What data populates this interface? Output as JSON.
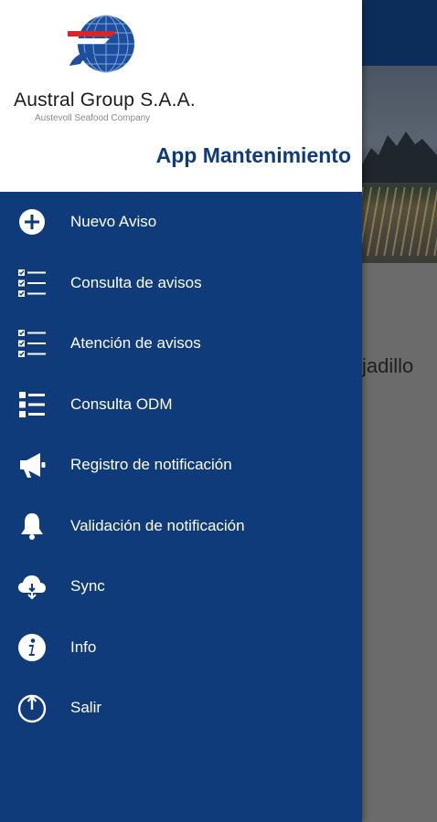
{
  "background": {
    "partial_text": "jadillo"
  },
  "header": {
    "company": "Austral Group S.A.A.",
    "tagline": "Austevoll Seafood Company",
    "app_title": "App Mantenimiento"
  },
  "menu": {
    "items": [
      {
        "label": "Nuevo Aviso",
        "icon": "plus-circle-icon"
      },
      {
        "label": "Consulta de avisos",
        "icon": "checklist-icon"
      },
      {
        "label": "Atención de avisos",
        "icon": "checklist-icon"
      },
      {
        "label": "Consulta ODM",
        "icon": "list-icon"
      },
      {
        "label": "Registro de notificación",
        "icon": "megaphone-icon"
      },
      {
        "label": "Validación de notificación",
        "icon": "bell-icon"
      },
      {
        "label": "Sync",
        "icon": "cloud-download-icon"
      },
      {
        "label": "Info",
        "icon": "info-icon"
      },
      {
        "label": "Salir",
        "icon": "power-icon"
      }
    ]
  },
  "colors": {
    "drawer": "#0f3b7a",
    "accent": "#0f3b7a",
    "topbar": "#0c2d5a"
  }
}
